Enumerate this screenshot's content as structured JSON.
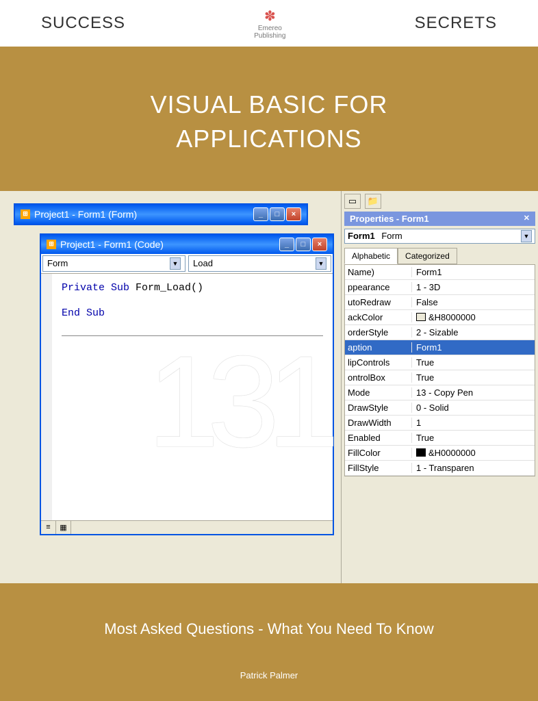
{
  "header": {
    "left": "SUCCESS",
    "right": "SECRETS",
    "publisher1": "Emereo",
    "publisher2": "Publishing"
  },
  "title": {
    "line1": "VISUAL BASIC FOR",
    "line2": "APPLICATIONS"
  },
  "big_number": "131",
  "subtitle": "Most Asked Questions - What You Need To Know",
  "author": "Patrick Palmer",
  "form_window": {
    "title": "Project1 - Form1 (Form)"
  },
  "code_window": {
    "title": "Project1 - Form1 (Code)",
    "object": "Form",
    "event": "Load",
    "lines": [
      {
        "kw": "Private Sub",
        "rest": " Form_Load()"
      },
      {
        "kw": "End Sub",
        "rest": ""
      }
    ]
  },
  "props": {
    "title": "Properties - Form1",
    "object_name": "Form1",
    "object_type": "Form",
    "tab1": "Alphabetic",
    "tab2": "Categorized",
    "rows": [
      {
        "k": "Name)",
        "v": "Form1"
      },
      {
        "k": "ppearance",
        "v": "1 - 3D"
      },
      {
        "k": "utoRedraw",
        "v": "False"
      },
      {
        "k": "ackColor",
        "v": "&H8000000",
        "swatch": "#ece9d8"
      },
      {
        "k": "orderStyle",
        "v": "2 - Sizable"
      },
      {
        "k": "aption",
        "v": "Form1",
        "sel": true
      },
      {
        "k": "lipControls",
        "v": "True"
      },
      {
        "k": "ontrolBox",
        "v": "True"
      },
      {
        "k": "Mode",
        "v": "13 - Copy Pen"
      },
      {
        "k": "DrawStyle",
        "v": "0 - Solid"
      },
      {
        "k": "DrawWidth",
        "v": "1"
      },
      {
        "k": "Enabled",
        "v": "True"
      },
      {
        "k": "FillColor",
        "v": "&H0000000",
        "swatch": "#000000"
      },
      {
        "k": "FillStyle",
        "v": "1 - Transparen"
      }
    ]
  }
}
